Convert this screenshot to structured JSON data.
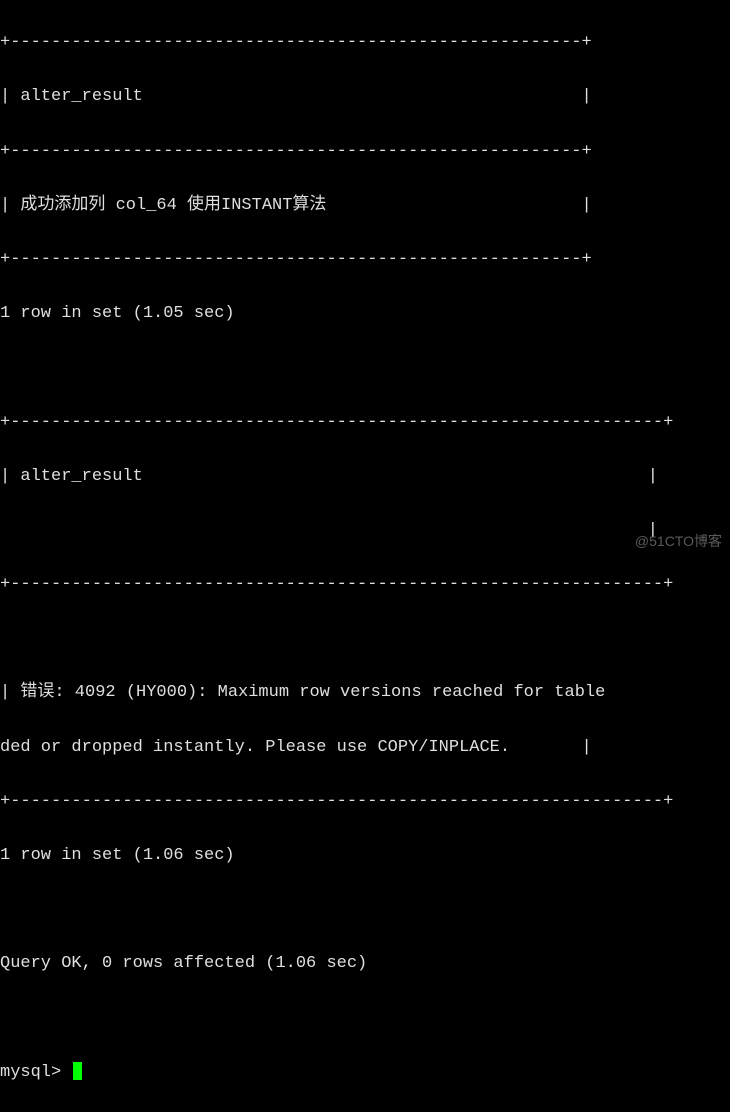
{
  "terminal": {
    "border1_top": "+--------------------------------------------------------+",
    "header1": "| alter_result                                           |",
    "border1_mid": "+--------------------------------------------------------+",
    "row1": "| 成功添加列 col_64 使用INSTANT算法                         |",
    "border1_bot": "+--------------------------------------------------------+",
    "result1": "1 row in set (1.05 sec)",
    "blank": " ",
    "border2_top": "+----------------------------------------------------------------+",
    "header2": "| alter_result",
    "header2_pipe": "|",
    "border2_mid": "+----------------------------------------------------------------+",
    "row2_line1": "| 错误: 4092 (HY000): Maximum row versions reached for table",
    "row2_line2": "ded or dropped instantly. Please use COPY/INPLACE.       |",
    "border2_bot": "+----------------------------------------------------------------+",
    "result2": "1 row in set (1.06 sec)",
    "query_ok": "Query OK, 0 rows affected (1.06 sec)",
    "prompt": "mysql> "
  },
  "watermark": "@51CTO博客"
}
